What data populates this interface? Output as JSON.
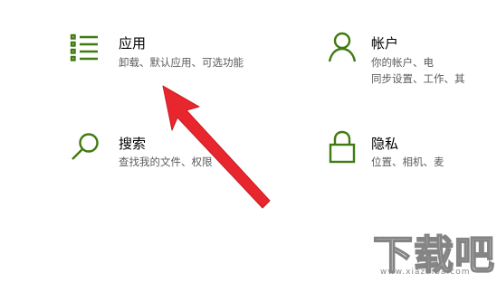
{
  "settings_tiles": [
    {
      "title": "应用",
      "description": "卸载、默认应用、可选功能",
      "icon": "apps-list-icon"
    },
    {
      "title": "帐户",
      "description": [
        "你的帐户、电",
        "同步设置、工作、其"
      ],
      "icon": "person-icon"
    },
    {
      "title": "搜索",
      "description": "查找我的文件、权限",
      "icon": "search-icon"
    },
    {
      "title": "隐私",
      "description": "位置、相机、麦",
      "icon": "lock-icon"
    }
  ],
  "annotation": {
    "type": "red-arrow",
    "color": "#e8262d",
    "points_to": "应用"
  },
  "watermark": {
    "text": "下载吧",
    "subtext": "www.xiazaiba.com"
  },
  "colors": {
    "icon": "#3f7b11",
    "title": "#000000",
    "description": "#5d5d5d",
    "background": "#ffffff"
  }
}
